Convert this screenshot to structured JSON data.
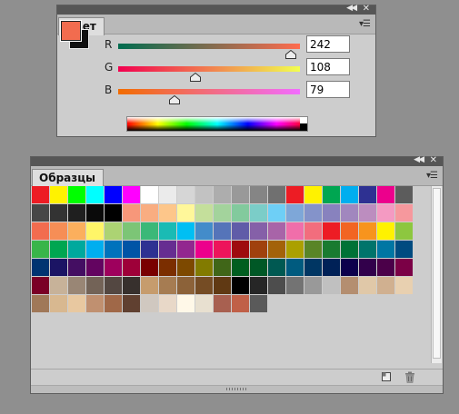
{
  "color_panel": {
    "tab_label": "Цвет",
    "foreground": "#f26c4f",
    "background": "#111111",
    "channels": [
      {
        "label": "R",
        "value": "242",
        "fraction": 0.949,
        "gradient_from": "#006c4f",
        "gradient_to": "#ff6c4f"
      },
      {
        "label": "G",
        "value": "108",
        "fraction": 0.424,
        "gradient_from": "#f2004f",
        "gradient_to": "#f2ff4f"
      },
      {
        "label": "B",
        "value": "79",
        "fraction": 0.31,
        "gradient_from": "#f26c00",
        "gradient_to": "#f26cff"
      }
    ]
  },
  "swatches_panel": {
    "tab_label": "Образцы",
    "swatches": [
      "#ed1c24",
      "#fff200",
      "#00ff00",
      "#00ffff",
      "#0000ff",
      "#ff00ff",
      "#ffffff",
      "#ebebeb",
      "#d6d6d6",
      "#c2c2c2",
      "#adadad",
      "#999999",
      "#858585",
      "#707070",
      "#ed1c24",
      "#fff200",
      "#00a651",
      "#00aeef",
      "#2e3192",
      "#ec008c",
      "#5c5c5c",
      "#474747",
      "#333333",
      "#1f1f1f",
      "#0a0a0a",
      "#000000",
      "#f7977a",
      "#f9ad81",
      "#fdc68a",
      "#fff79a",
      "#c4df9b",
      "#a3d39c",
      "#82ca9d",
      "#7bcdc8",
      "#6ecff6",
      "#7ea7d8",
      "#8493ca",
      "#8882be",
      "#a187be",
      "#bc8dbf",
      "#f49ac2",
      "#f6989d",
      "#f26c4f",
      "#f68e56",
      "#fbaf5d",
      "#fff568",
      "#acd373",
      "#7cc576",
      "#3bb878",
      "#1abbb4",
      "#00bff3",
      "#438cca",
      "#5574b9",
      "#605ca8",
      "#8560a8",
      "#a864a8",
      "#f06eaa",
      "#f26d7d",
      "#ed1c24",
      "#f26522",
      "#f7941d",
      "#fff200",
      "#8dc73f",
      "#39b54a",
      "#00a651",
      "#00a99d",
      "#00aeef",
      "#0072bc",
      "#0054a6",
      "#2e3192",
      "#662d91",
      "#92278f",
      "#ec008c",
      "#ed145b",
      "#9e0b0f",
      "#a0410d",
      "#a36209",
      "#aba000",
      "#598527",
      "#197b30",
      "#007236",
      "#00746b",
      "#0076a3",
      "#004b80",
      "#003471",
      "#1b1464",
      "#440e62",
      "#630460",
      "#9e005d",
      "#9e0039",
      "#790000",
      "#7b2e00",
      "#7d4900",
      "#827b00",
      "#406618",
      "#005e20",
      "#005826",
      "#005952",
      "#005b7f",
      "#003663",
      "#002157",
      "#0d004c",
      "#32004b",
      "#4b0049",
      "#7b0046",
      "#7a0026",
      "#c7b299",
      "#998675",
      "#736357",
      "#534741",
      "#37302d",
      "#c69c6d",
      "#a67c52",
      "#8c6239",
      "#754c24",
      "#603913",
      "#000000",
      "#262626",
      "#4d4d4d",
      "#737373",
      "#999999",
      "#c0c0c0",
      "#b48e70",
      "#e0c8a8",
      "#d0b090",
      "#e8d0b0",
      "#a07858",
      "#d8b890",
      "#e8c8a0",
      "#c09070",
      "#a06848",
      "#604030",
      "#d0c8c0",
      "#e8d8c8",
      "#fff8e8",
      "#e8e0d0",
      "#a86050",
      "#c06048",
      "#5a5a5a"
    ]
  }
}
